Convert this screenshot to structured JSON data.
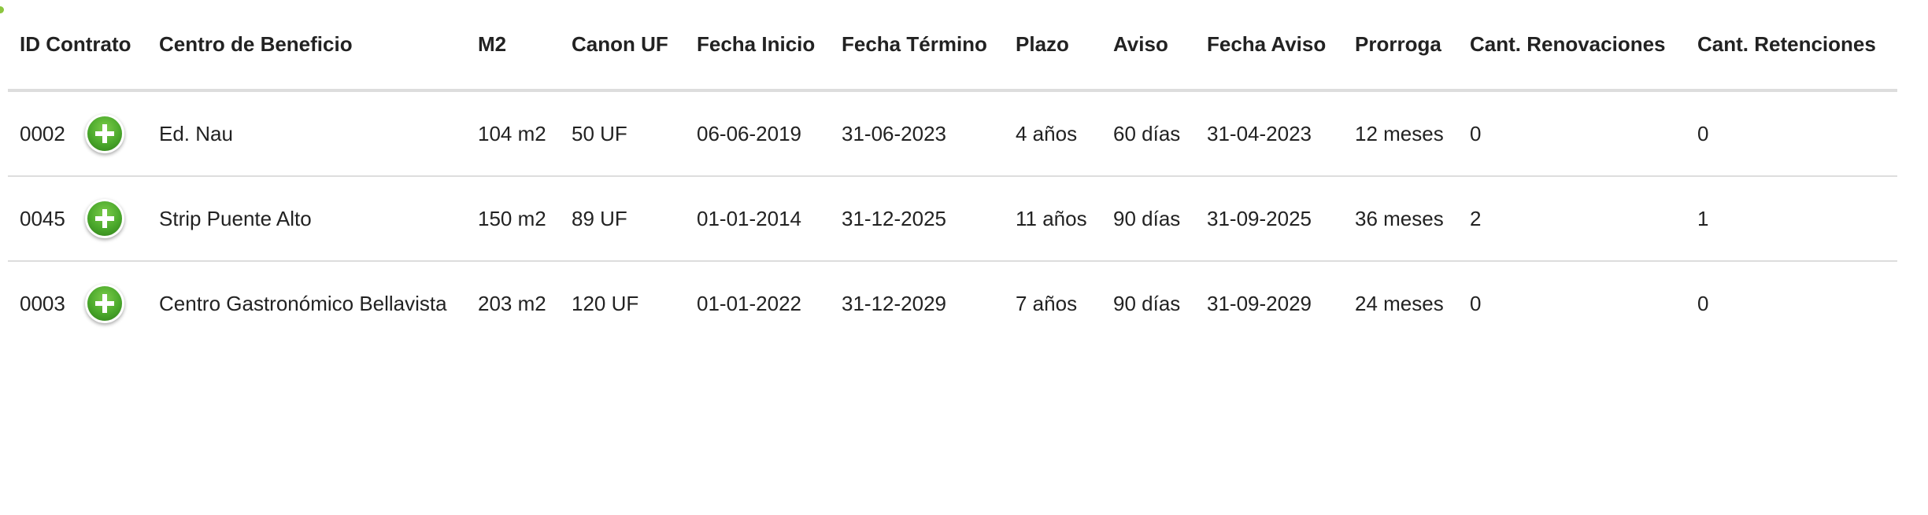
{
  "table": {
    "headers": [
      "ID Contrato",
      "Centro de Beneficio",
      "M2",
      "Canon UF",
      "Fecha Inicio",
      "Fecha Término",
      "Plazo",
      "Aviso",
      "Fecha Aviso",
      "Prorroga",
      "Cant. Renovaciones",
      "Cant. Retenciones"
    ],
    "rows": [
      {
        "id": "0002",
        "centro": "Ed. Nau",
        "m2": "104 m2",
        "canon": "50 UF",
        "fecha_inicio": "06-06-2019",
        "fecha_termino": "31-06-2023",
        "plazo": "4 años",
        "aviso": "60 días",
        "fecha_aviso": "31-04-2023",
        "prorroga": "12 meses",
        "renovaciones": "0",
        "retenciones": "0"
      },
      {
        "id": "0045",
        "centro": "Strip Puente Alto",
        "m2": "150 m2",
        "canon": "89 UF",
        "fecha_inicio": "01-01-2014",
        "fecha_termino": "31-12-2025",
        "plazo": "11 años",
        "aviso": "90 días",
        "fecha_aviso": "31-09-2025",
        "prorroga": "36 meses",
        "renovaciones": "2",
        "retenciones": "1"
      },
      {
        "id": "0003",
        "centro": "Centro Gastronómico Bellavista",
        "m2": "203 m2",
        "canon": "120 UF",
        "fecha_inicio": "01-01-2022",
        "fecha_termino": "31-12-2029",
        "plazo": "7 años",
        "aviso": "90 días",
        "fecha_aviso": "31-09-2029",
        "prorroga": "24 meses",
        "renovaciones": "0",
        "retenciones": "0"
      }
    ]
  },
  "icons": {
    "expand": "plus-circle-icon"
  },
  "colors": {
    "accent_green": "#4aa82b",
    "border": "#dddddd"
  }
}
